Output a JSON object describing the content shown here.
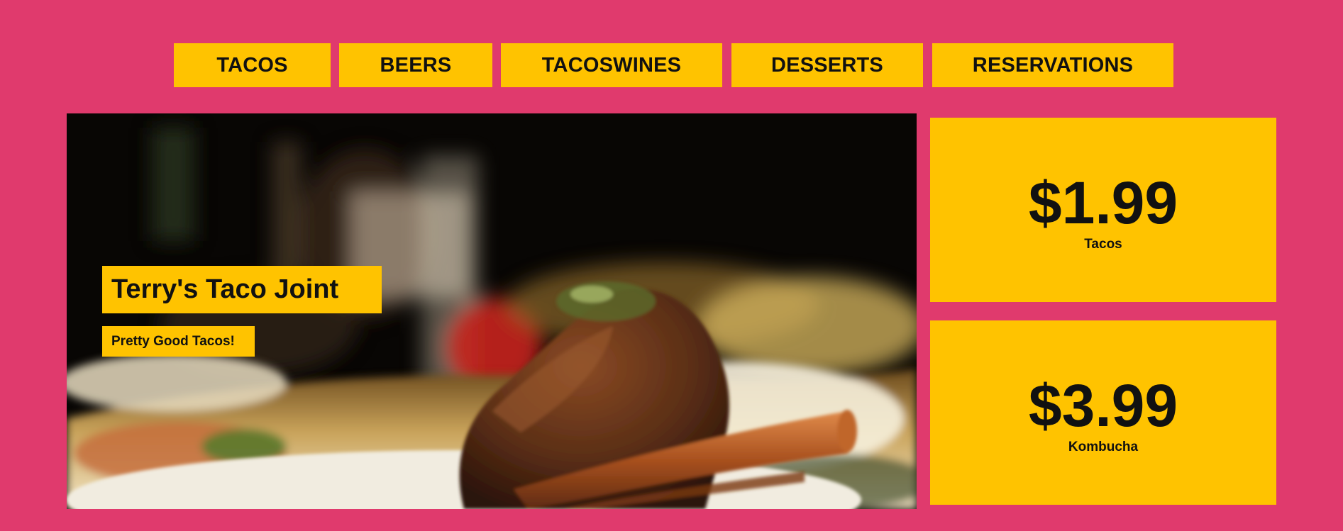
{
  "nav": {
    "items": [
      {
        "label": "TACOS"
      },
      {
        "label": "BEERS"
      },
      {
        "label": "TACOSWINES"
      },
      {
        "label": "DESSERTS"
      },
      {
        "label": "RESERVATIONS"
      }
    ]
  },
  "hero": {
    "title": "Terry's Taco Joint",
    "subtitle": "Pretty Good Tacos!",
    "image_subject": "plated braised short rib with wine glass in background"
  },
  "prices": [
    {
      "amount": "$1.99",
      "label": "Tacos"
    },
    {
      "amount": "$3.99",
      "label": "Kombucha"
    }
  ],
  "colors": {
    "background": "#e03a6d",
    "accent": "#ffc300",
    "text": "#111111"
  }
}
